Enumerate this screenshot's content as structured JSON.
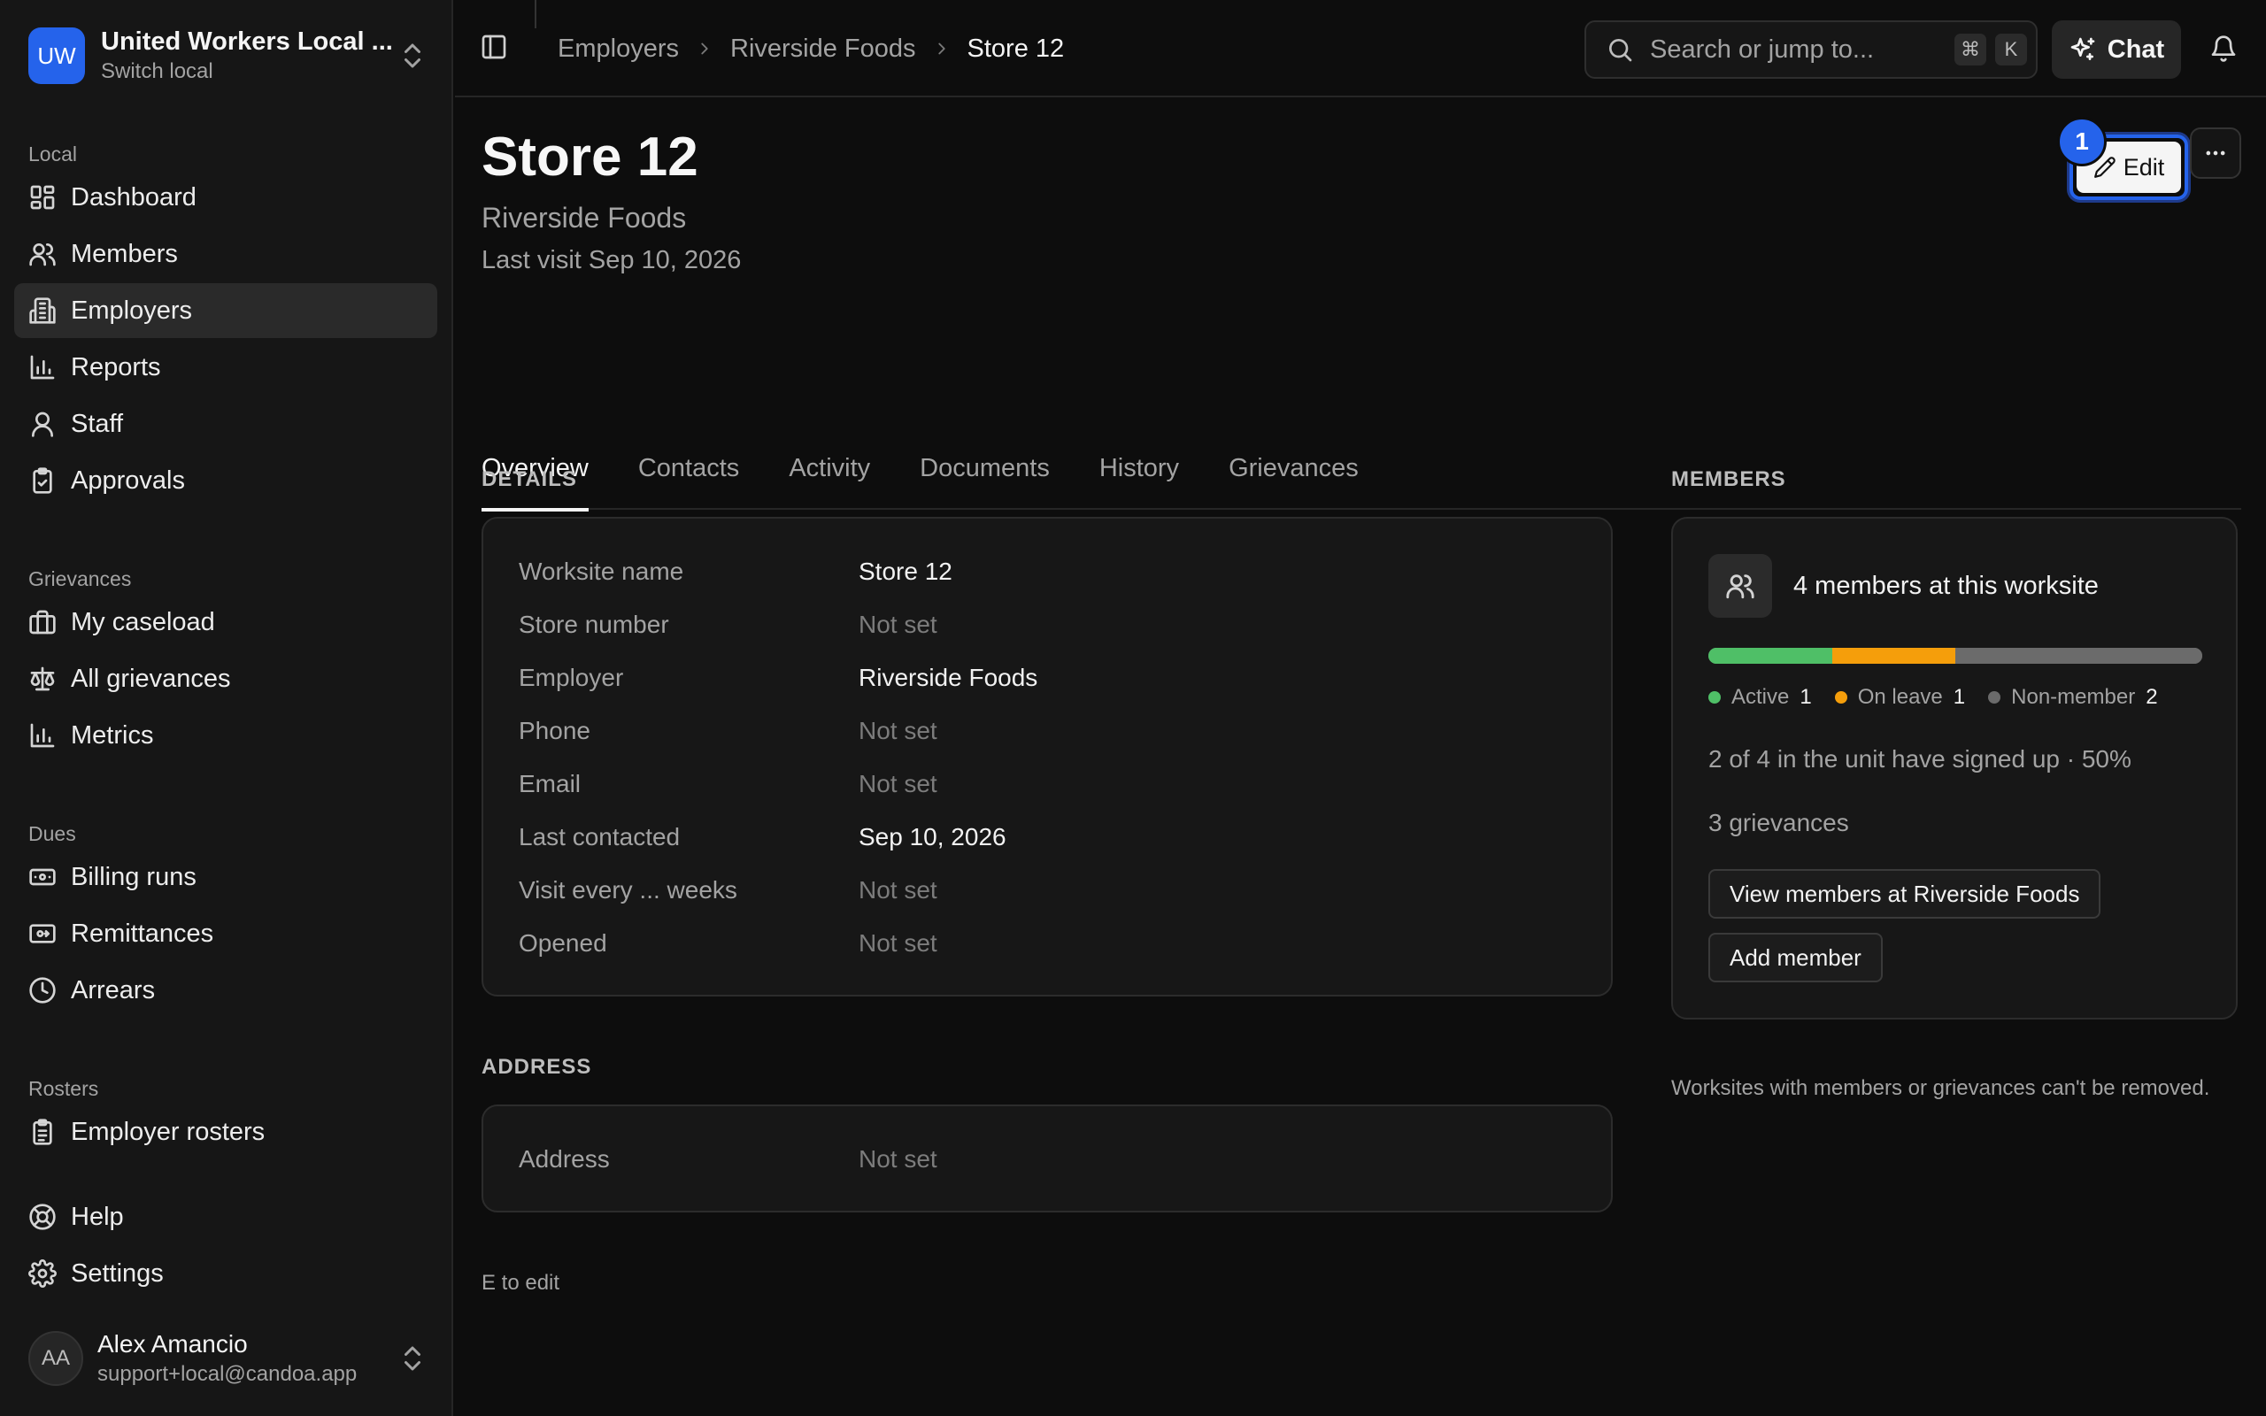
{
  "local": {
    "initials": "UW",
    "name": "United Workers Local ...",
    "switch_label": "Switch local"
  },
  "sidebar": {
    "local_heading": "Local",
    "local_items": [
      {
        "label": "Dashboard",
        "icon": "dashboard-icon"
      },
      {
        "label": "Members",
        "icon": "users-icon"
      },
      {
        "label": "Employers",
        "icon": "building-icon",
        "active": true
      },
      {
        "label": "Reports",
        "icon": "bar-chart-icon"
      },
      {
        "label": "Staff",
        "icon": "user-icon"
      },
      {
        "label": "Approvals",
        "icon": "clipboard-check-icon"
      }
    ],
    "grievances_heading": "Grievances",
    "grievance_items": [
      {
        "label": "My caseload",
        "icon": "briefcase-icon"
      },
      {
        "label": "All grievances",
        "icon": "scale-icon"
      },
      {
        "label": "Metrics",
        "icon": "bar-chart-icon"
      }
    ],
    "dues_heading": "Dues",
    "dues_items": [
      {
        "label": "Billing runs",
        "icon": "banknote-icon"
      },
      {
        "label": "Remittances",
        "icon": "remittance-icon"
      },
      {
        "label": "Arrears",
        "icon": "clock-icon"
      }
    ],
    "rosters_heading": "Rosters",
    "roster_items": [
      {
        "label": "Employer rosters",
        "icon": "clipboard-list-icon"
      }
    ],
    "footer_items": [
      {
        "label": "Help",
        "icon": "lifebuoy-icon"
      },
      {
        "label": "Settings",
        "icon": "gear-icon"
      }
    ]
  },
  "user": {
    "initials": "AA",
    "name": "Alex Amancio",
    "email": "support+local@candoa.app"
  },
  "topbar": {
    "breadcrumbs": [
      "Employers",
      "Riverside Foods",
      "Store 12"
    ],
    "search_placeholder": "Search or jump to...",
    "search_shortcut": [
      "⌘",
      "K"
    ],
    "chat_label": "Chat"
  },
  "page": {
    "title": "Store 12",
    "subtitle": "Riverside Foods",
    "meta": "Last visit Sep 10, 2026",
    "edit_label": "Edit",
    "edit_badge": "1",
    "tabs": [
      "Overview",
      "Contacts",
      "Activity",
      "Documents",
      "History",
      "Grievances"
    ],
    "active_tab": "Overview"
  },
  "details": {
    "heading": "DETAILS",
    "rows": [
      {
        "key": "Worksite name",
        "value": "Store 12",
        "muted": false
      },
      {
        "key": "Store number",
        "value": "Not set",
        "muted": true
      },
      {
        "key": "Employer",
        "value": "Riverside Foods",
        "muted": false
      },
      {
        "key": "Phone",
        "value": "Not set",
        "muted": true
      },
      {
        "key": "Email",
        "value": "Not set",
        "muted": true
      },
      {
        "key": "Last contacted",
        "value": "Sep 10, 2026",
        "muted": false
      },
      {
        "key": "Visit every ... weeks",
        "value": "Not set",
        "muted": true
      },
      {
        "key": "Opened",
        "value": "Not set",
        "muted": true
      }
    ]
  },
  "address": {
    "heading": "ADDRESS",
    "rows": [
      {
        "key": "Address",
        "value": "Not set",
        "muted": true
      }
    ]
  },
  "members": {
    "heading": "MEMBERS",
    "count_label": "4 members at this worksite",
    "breakdown": [
      {
        "label": "Active",
        "count": 1,
        "color": "#4fbf67"
      },
      {
        "label": "On leave",
        "count": 1,
        "color": "#f59e0b"
      },
      {
        "label": "Non-member",
        "count": 2,
        "color": "#6b6b6b"
      }
    ],
    "signed_up": "2 of 4 in the unit have signed up · 50%",
    "grievances": "3 grievances",
    "view_button": "View members at Riverside Foods",
    "add_button": "Add member",
    "note": "Worksites with members or grievances can't be removed."
  },
  "hint": "E to edit"
}
